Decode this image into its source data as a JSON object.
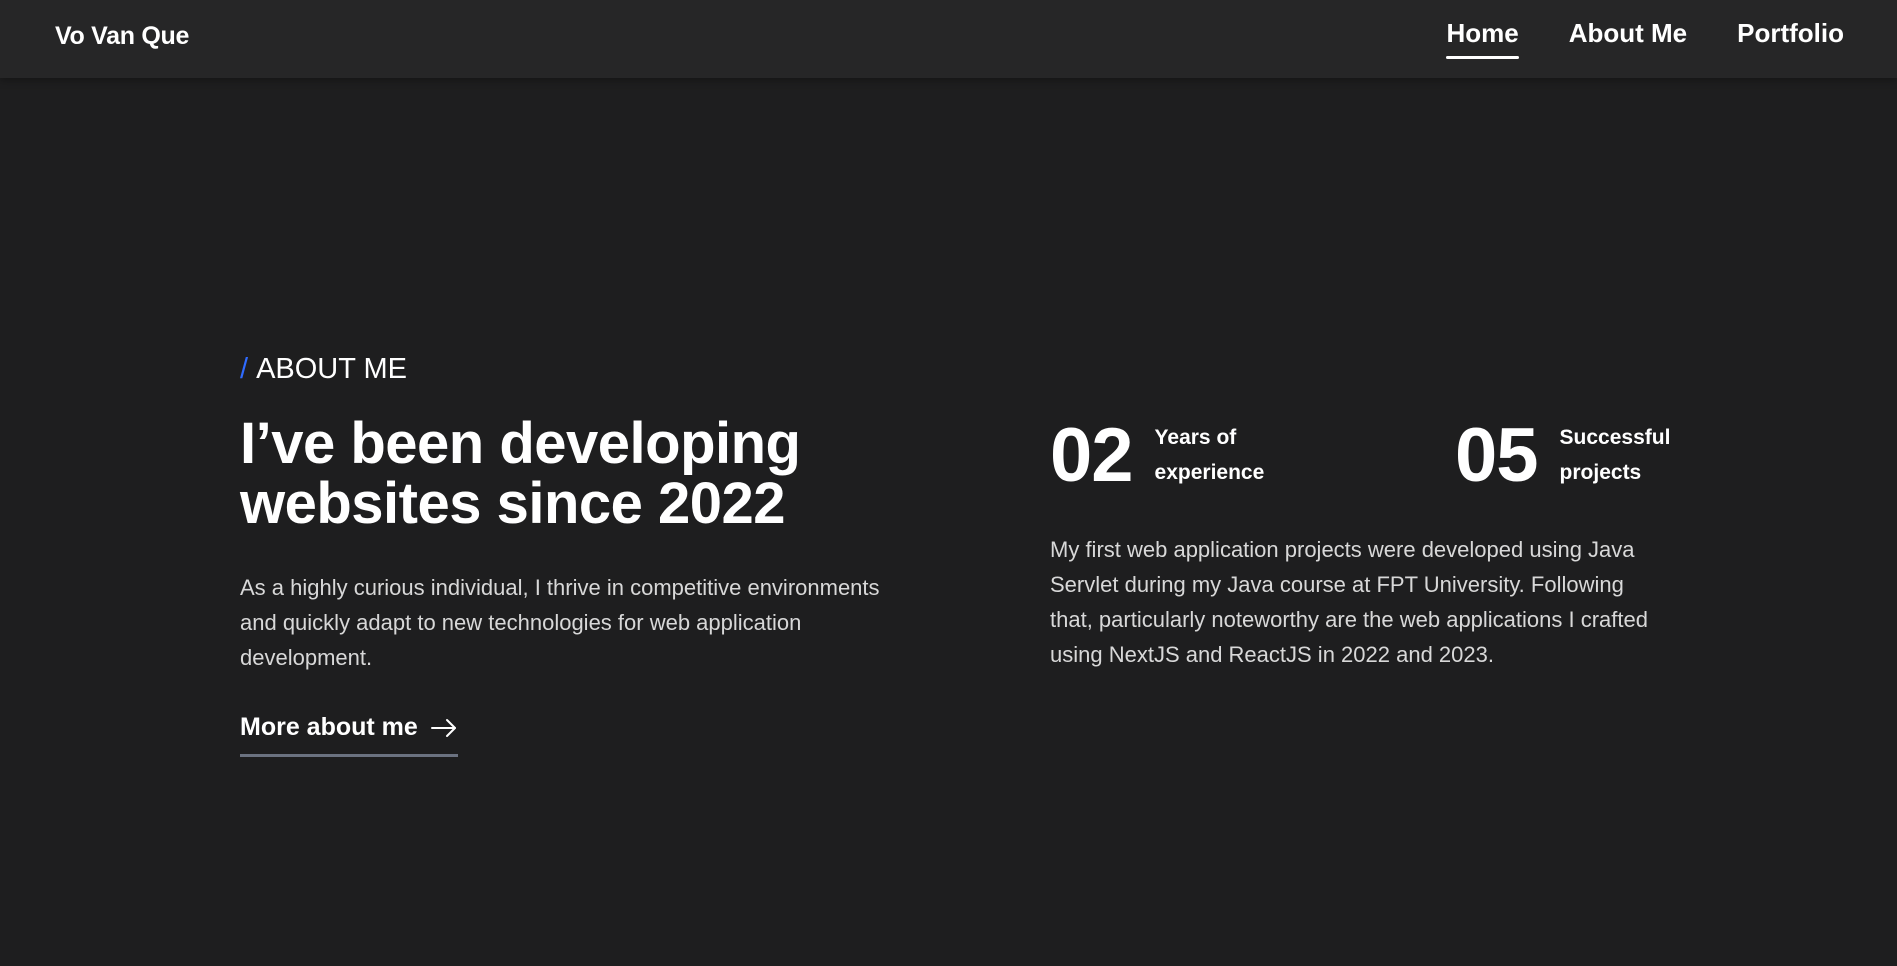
{
  "header": {
    "brand": "Vo Van Que",
    "nav": [
      {
        "label": "Home",
        "active": true
      },
      {
        "label": "About Me",
        "active": false
      },
      {
        "label": "Portfolio",
        "active": false
      }
    ]
  },
  "about": {
    "slash": "/",
    "section_label": "ABOUT ME",
    "headline_line1": "I’ve been developing",
    "headline_line2": "websites since 2022",
    "lead": "As a highly curious individual, I thrive in competitive environments and quickly adapt to new technologies for web application development.",
    "more_link_label": "More about me",
    "stats": [
      {
        "number": "02",
        "label_line1": "Years of",
        "label_line2": "experience"
      },
      {
        "number": "05",
        "label_line1": "Successful",
        "label_line2": "projects"
      }
    ],
    "description": "My first web application projects were developed using Java Servlet during my Java course at FPT University. Following that, particularly noteworthy are the web applications I crafted using NextJS and ReactJS in 2022 and 2023."
  },
  "colors": {
    "background": "#1e1e1f",
    "header_background": "#262627",
    "accent": "#2f6bff",
    "text": "#ffffff",
    "muted_text": "#d8d8d8",
    "link_underline": "#6b7280"
  },
  "icons": {
    "more_link": "arrow-right-icon"
  }
}
